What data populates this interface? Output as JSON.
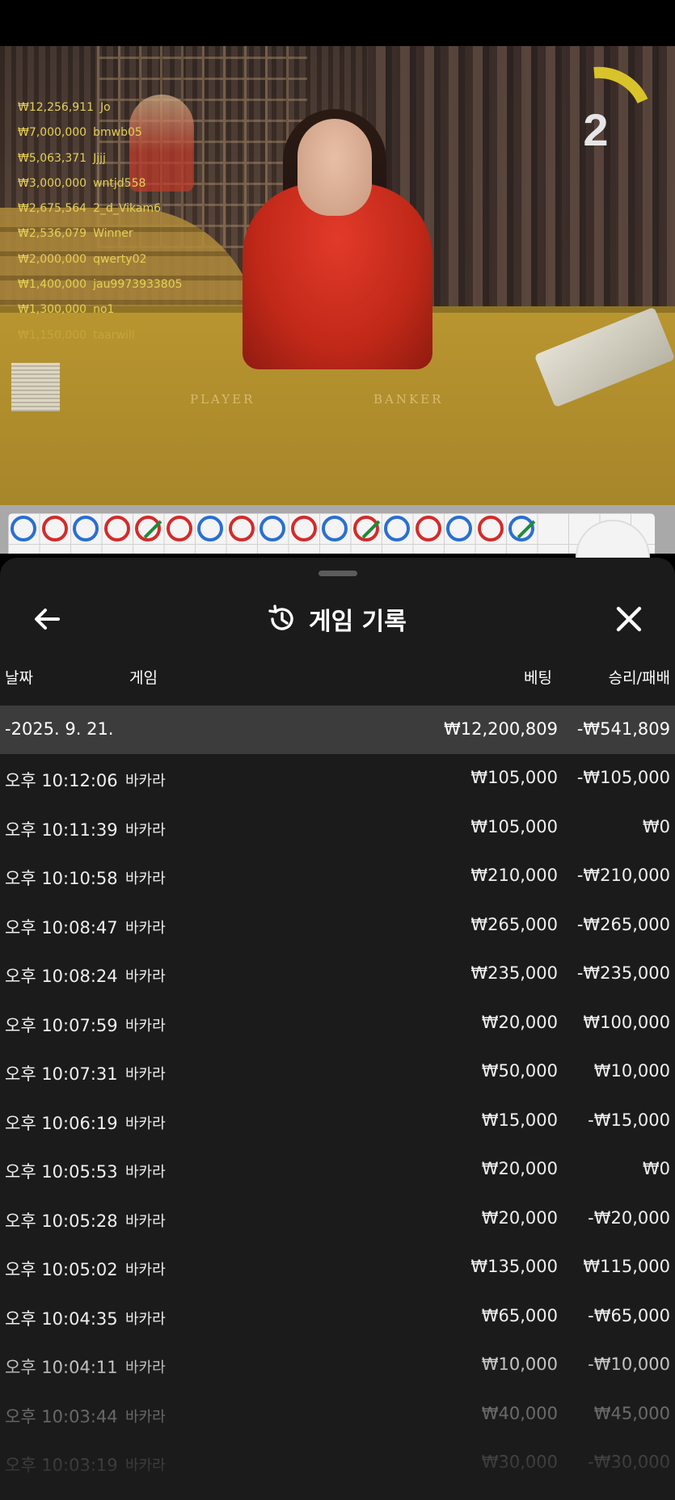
{
  "video": {
    "table_labels": {
      "player": "PLAYER",
      "banker": "BANKER"
    },
    "timer": {
      "value": "2"
    },
    "leaderboard": [
      {
        "amount": "₩12,256,911",
        "name": "Jo"
      },
      {
        "amount": "₩7,000,000",
        "name": "bmwb05"
      },
      {
        "amount": "₩5,063,371",
        "name": "Jjjj"
      },
      {
        "amount": "₩3,000,000",
        "name": "wntjd558"
      },
      {
        "amount": "₩2,675,564",
        "name": "2_d_Vikam6"
      },
      {
        "amount": "₩2,536,079",
        "name": "Winner"
      },
      {
        "amount": "₩2,000,000",
        "name": "qwerty02"
      },
      {
        "amount": "₩1,400,000",
        "name": "jau9973933805"
      },
      {
        "amount": "₩1,300,000",
        "name": "no1"
      },
      {
        "amount": "₩1,150,000",
        "name": "taarwill"
      }
    ]
  },
  "roadmap": {
    "top_row": [
      "B",
      "B",
      "B",
      "B",
      "T",
      "B",
      "B",
      "B",
      "B",
      "B",
      "B",
      "T",
      "B",
      "B",
      "B",
      "B",
      "T"
    ],
    "top_row_colors": [
      "blue",
      "red",
      "blue",
      "red",
      "red",
      "red",
      "blue",
      "red",
      "blue",
      "red",
      "blue",
      "red",
      "blue",
      "red",
      "blue",
      "red",
      "blue"
    ]
  },
  "sheet": {
    "title": "게임 기록",
    "columns": {
      "date": "날짜",
      "game": "게임",
      "bet": "베팅",
      "result": "승리/패배"
    },
    "day": {
      "date": "-2025. 9. 21.",
      "bet": "₩12,200,809",
      "result": "-₩541,809"
    },
    "rows": [
      {
        "time": "오후 10:12:06",
        "game": "바카라",
        "bet": "₩105,000",
        "result": "-₩105,000"
      },
      {
        "time": "오후 10:11:39",
        "game": "바카라",
        "bet": "₩105,000",
        "result": "₩0"
      },
      {
        "time": "오후 10:10:58",
        "game": "바카라",
        "bet": "₩210,000",
        "result": "-₩210,000"
      },
      {
        "time": "오후 10:08:47",
        "game": "바카라",
        "bet": "₩265,000",
        "result": "-₩265,000"
      },
      {
        "time": "오후 10:08:24",
        "game": "바카라",
        "bet": "₩235,000",
        "result": "-₩235,000"
      },
      {
        "time": "오후 10:07:59",
        "game": "바카라",
        "bet": "₩20,000",
        "result": "₩100,000"
      },
      {
        "time": "오후 10:07:31",
        "game": "바카라",
        "bet": "₩50,000",
        "result": "₩10,000"
      },
      {
        "time": "오후 10:06:19",
        "game": "바카라",
        "bet": "₩15,000",
        "result": "-₩15,000"
      },
      {
        "time": "오후 10:05:53",
        "game": "바카라",
        "bet": "₩20,000",
        "result": "₩0"
      },
      {
        "time": "오후 10:05:28",
        "game": "바카라",
        "bet": "₩20,000",
        "result": "-₩20,000"
      },
      {
        "time": "오후 10:05:02",
        "game": "바카라",
        "bet": "₩135,000",
        "result": "₩115,000"
      },
      {
        "time": "오후 10:04:35",
        "game": "바카라",
        "bet": "₩65,000",
        "result": "-₩65,000"
      },
      {
        "time": "오후 10:04:11",
        "game": "바카라",
        "bet": "₩10,000",
        "result": "-₩10,000"
      },
      {
        "time": "오후 10:03:44",
        "game": "바카라",
        "bet": "₩40,000",
        "result": "₩45,000"
      },
      {
        "time": "오후 10:03:19",
        "game": "바카라",
        "bet": "₩30,000",
        "result": "-₩30,000"
      }
    ]
  },
  "colors": {
    "sheet_bg": "#1b1b1b",
    "day_row_bg": "#3c3c3c",
    "leaderboard_text": "#e5cf55",
    "banker_red": "#d32b2b",
    "player_blue": "#2a6fd1",
    "tie_green": "#1f8a3a"
  }
}
